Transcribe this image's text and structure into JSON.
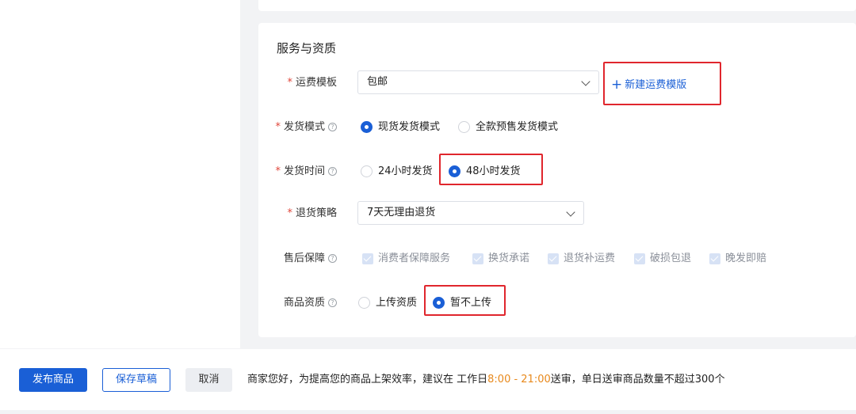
{
  "section": {
    "title": "服务与资质"
  },
  "shipping_template": {
    "label": "运费模板",
    "value": "包邮",
    "add_link": "新建运费模版"
  },
  "ship_mode": {
    "label": "发货模式",
    "options": [
      {
        "label": "现货发货模式",
        "checked": true
      },
      {
        "label": "全款预售发货模式",
        "checked": false
      }
    ]
  },
  "ship_time": {
    "label": "发货时间",
    "options": [
      {
        "label": "24小时发货",
        "checked": false
      },
      {
        "label": "48小时发货",
        "checked": true
      }
    ]
  },
  "return_policy": {
    "label": "退货策略",
    "value": "7天无理由退货"
  },
  "after_sales": {
    "label": "售后保障",
    "items": [
      "消费者保障服务",
      "换货承诺",
      "退货补运费",
      "破损包退",
      "晚发即赔"
    ]
  },
  "qualification": {
    "label": "商品资质",
    "options": [
      {
        "label": "上传资质",
        "checked": false
      },
      {
        "label": "暂不上传",
        "checked": true
      }
    ]
  },
  "footer": {
    "publish": "发布商品",
    "save_draft": "保存草稿",
    "cancel": "取消",
    "notice_prefix": "商家您好，为提高您的商品上架效率，建议在 工作日",
    "notice_time": "8:00 - 21:00",
    "notice_suffix": "送审，单日送审商品数量不超过300个"
  },
  "colors": {
    "primary": "#1a5fd6",
    "highlight": "#e0262d",
    "required": "#e0463a",
    "time": "#e8891c"
  }
}
